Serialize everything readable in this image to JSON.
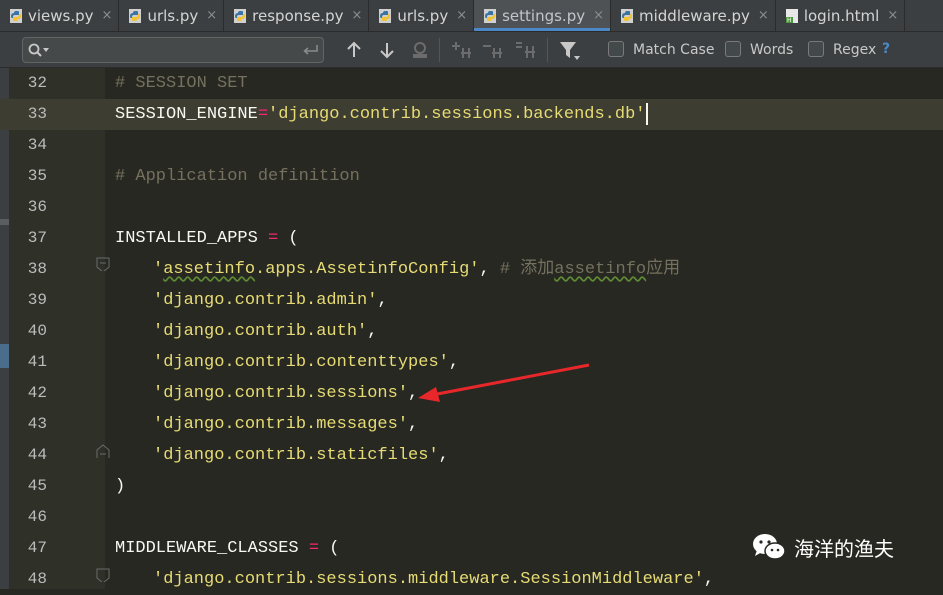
{
  "tabs": [
    {
      "label": "views.py",
      "icon": "python-file-icon",
      "active": false
    },
    {
      "label": "urls.py",
      "icon": "python-file-icon",
      "active": false
    },
    {
      "label": "response.py",
      "icon": "python-file-icon",
      "active": false
    },
    {
      "label": "urls.py",
      "icon": "python-file-icon",
      "active": false
    },
    {
      "label": "settings.py",
      "icon": "python-file-icon",
      "active": true
    },
    {
      "label": "middleware.py",
      "icon": "python-file-icon",
      "active": false
    },
    {
      "label": "login.html",
      "icon": "html-file-icon",
      "active": false
    }
  ],
  "tab_close_glyph": "×",
  "search": {
    "value": "",
    "match_case_label": "Match Case",
    "words_label": "Words",
    "regex_label": "Regex",
    "help_label": "?"
  },
  "colors": {
    "background": "#272822",
    "current_line": "#3e3d32",
    "comment": "#75715e",
    "string": "#e6db74",
    "operator": "#f92672",
    "accent": "#4a88c7",
    "arrow": "#e8272a"
  },
  "editor": {
    "lines": [
      {
        "num": "32",
        "tokens": [
          {
            "t": "comment",
            "v": "# SESSION SET"
          }
        ]
      },
      {
        "num": "33",
        "current": true,
        "tokens": [
          {
            "t": "default",
            "v": "SESSION_ENGINE"
          },
          {
            "t": "op",
            "v": "="
          },
          {
            "t": "string",
            "v": "'django.contrib.sessions.backends.db'"
          }
        ]
      },
      {
        "num": "34",
        "tokens": []
      },
      {
        "num": "35",
        "tokens": [
          {
            "t": "comment",
            "v": "# Application definition"
          }
        ]
      },
      {
        "num": "36",
        "tokens": []
      },
      {
        "num": "37",
        "tokens": [
          {
            "t": "default",
            "v": "INSTALLED_APPS "
          },
          {
            "t": "op",
            "v": "="
          },
          {
            "t": "default",
            "v": " ("
          }
        ]
      },
      {
        "num": "38",
        "indent": true,
        "tokens": [
          {
            "t": "string",
            "v": "'"
          },
          {
            "t": "string-sq",
            "v": "assetinfo"
          },
          {
            "t": "string",
            "v": ".apps.AssetinfoConfig'"
          },
          {
            "t": "punct",
            "v": ", "
          },
          {
            "t": "comment",
            "v": "# 添加"
          },
          {
            "t": "comment-sq",
            "v": "assetinfo"
          },
          {
            "t": "comment",
            "v": "应用"
          }
        ]
      },
      {
        "num": "39",
        "indent": true,
        "tokens": [
          {
            "t": "string",
            "v": "'django.contrib.admin'"
          },
          {
            "t": "punct",
            "v": ","
          }
        ]
      },
      {
        "num": "40",
        "indent": true,
        "tokens": [
          {
            "t": "string",
            "v": "'django.contrib.auth'"
          },
          {
            "t": "punct",
            "v": ","
          }
        ]
      },
      {
        "num": "41",
        "indent": true,
        "tokens": [
          {
            "t": "string",
            "v": "'django.contrib.contenttypes'"
          },
          {
            "t": "punct",
            "v": ","
          }
        ]
      },
      {
        "num": "42",
        "indent": true,
        "tokens": [
          {
            "t": "string",
            "v": "'django.contrib.sessions'"
          },
          {
            "t": "punct",
            "v": ","
          }
        ]
      },
      {
        "num": "43",
        "indent": true,
        "tokens": [
          {
            "t": "string",
            "v": "'django.contrib.messages'"
          },
          {
            "t": "punct",
            "v": ","
          }
        ]
      },
      {
        "num": "44",
        "indent": true,
        "tokens": [
          {
            "t": "string",
            "v": "'django.contrib.staticfiles'"
          },
          {
            "t": "punct",
            "v": ","
          }
        ]
      },
      {
        "num": "45",
        "tokens": [
          {
            "t": "default",
            "v": ")"
          }
        ]
      },
      {
        "num": "46",
        "tokens": []
      },
      {
        "num": "47",
        "tokens": [
          {
            "t": "default",
            "v": "MIDDLEWARE_CLASSES "
          },
          {
            "t": "op",
            "v": "="
          },
          {
            "t": "default",
            "v": " ("
          }
        ]
      },
      {
        "num": "48",
        "indent": true,
        "tokens": [
          {
            "t": "string",
            "v": "'django.contrib.sessions.middleware.SessionMiddleware'"
          },
          {
            "t": "punct",
            "v": ","
          }
        ]
      }
    ]
  },
  "watermark": {
    "text": "海洋的渔夫",
    "icon": "wechat-icon"
  }
}
